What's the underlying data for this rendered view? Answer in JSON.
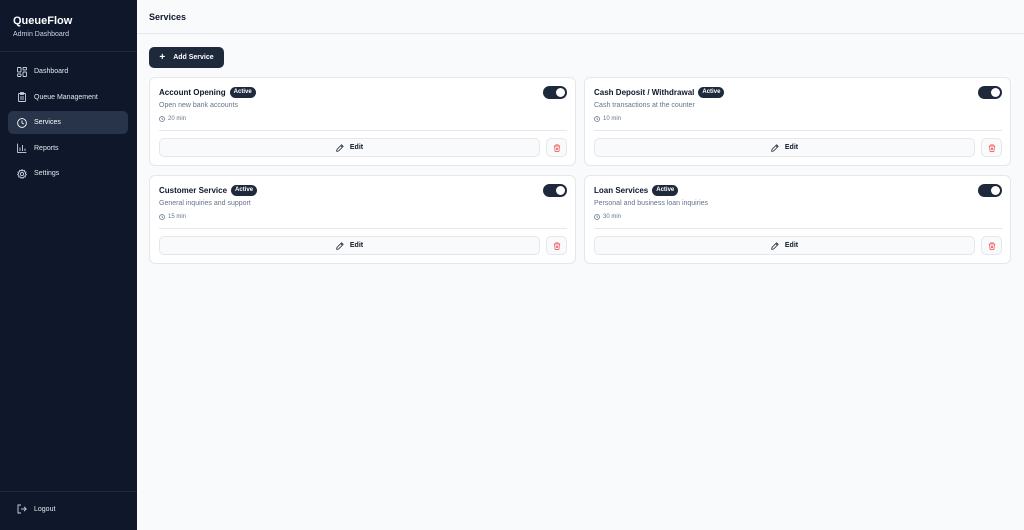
{
  "sidebar": {
    "brand": "QueueFlow",
    "subtitle": "Admin Dashboard",
    "items": [
      {
        "label": "Dashboard",
        "icon": "dashboard-icon"
      },
      {
        "label": "Queue Management",
        "icon": "clipboard-icon"
      },
      {
        "label": "Services",
        "icon": "clock-icon",
        "active": true
      },
      {
        "label": "Reports",
        "icon": "bar-chart-icon"
      },
      {
        "label": "Settings",
        "icon": "gear-icon"
      }
    ],
    "logout_label": "Logout"
  },
  "header": {
    "title": "Services"
  },
  "toolbar": {
    "add_label": "Add Service"
  },
  "services": [
    {
      "name": "Account Opening",
      "status": "Active",
      "description": "Open new bank accounts",
      "duration": "20 min",
      "enabled": true,
      "edit_label": "Edit"
    },
    {
      "name": "Cash Deposit / Withdrawal",
      "status": "Active",
      "description": "Cash transactions at the counter",
      "duration": "10 min",
      "enabled": true,
      "edit_label": "Edit"
    },
    {
      "name": "Customer Service",
      "status": "Active",
      "description": "General inquiries and support",
      "duration": "15 min",
      "enabled": true,
      "edit_label": "Edit"
    },
    {
      "name": "Loan Services",
      "status": "Active",
      "description": "Personal and business loan inquiries",
      "duration": "30 min",
      "enabled": true,
      "edit_label": "Edit"
    }
  ],
  "colors": {
    "sidebar_bg": "#0f172a",
    "accent": "#1e293b",
    "delete": "#ef4444"
  }
}
